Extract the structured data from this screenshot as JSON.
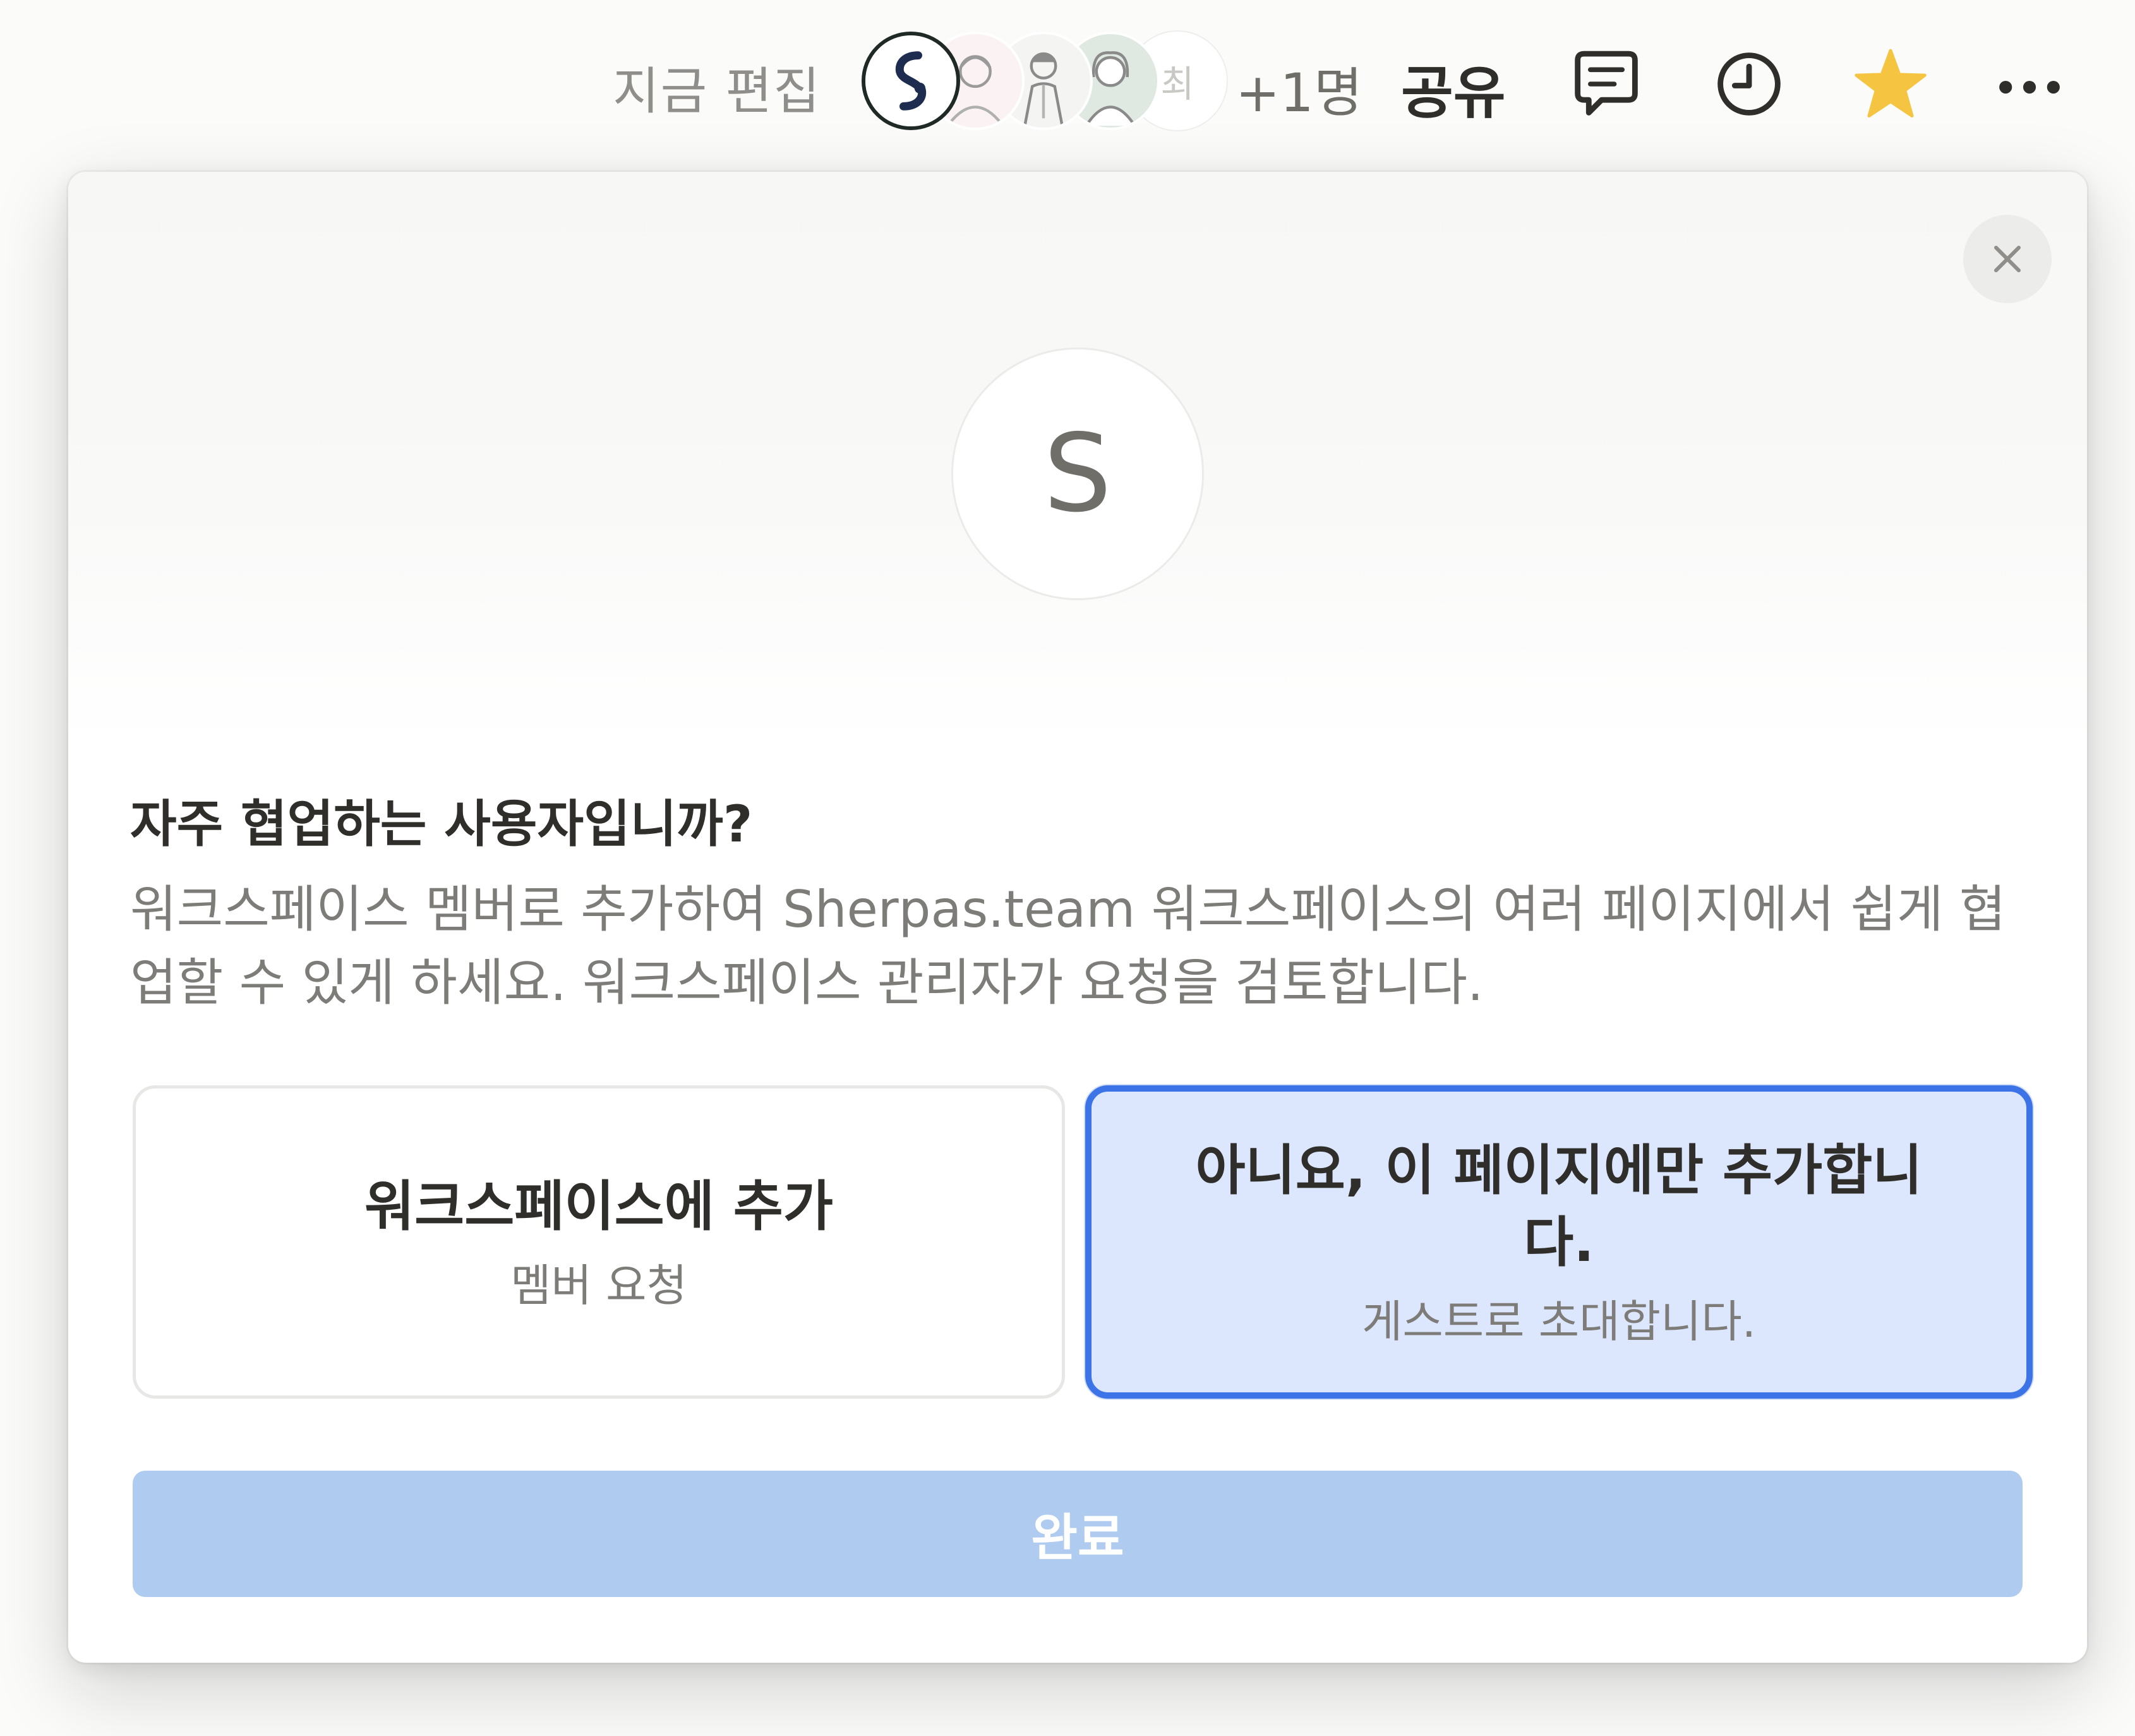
{
  "topbar": {
    "edit_status": "지금 편집",
    "avatars": [
      {
        "name": "brand-logo-avatar"
      },
      {
        "name": "user-avatar-1"
      },
      {
        "name": "user-avatar-2"
      },
      {
        "name": "user-avatar-3"
      },
      {
        "name": "user-avatar-4",
        "initial": "최"
      }
    ],
    "more_count": "+1명",
    "share_label": "공유",
    "icons": {
      "comment": "comment-icon",
      "history": "clock-icon",
      "favorite": "star-icon",
      "more": "more-dots-icon"
    },
    "star_color": "#f5c542"
  },
  "modal": {
    "workspace_initial": "S",
    "title": "자주 협업하는 사용자입니까?",
    "description": "워크스페이스 멤버로 추가하여 Sherpas.team 워크스페이스의 여러 페이지에서 쉽게 협업할 수 있게 하세요. 워크스페이스 관리자가 요청을 검토합니다.",
    "options": [
      {
        "title": "워크스페이스에 추가",
        "subtitle": "멤버 요청",
        "selected": false
      },
      {
        "title": "아니요, 이 페이지에만 추가합니다.",
        "subtitle": "게스트로 초대합니다.",
        "selected": true
      }
    ],
    "done_label": "완료",
    "accent_color": "#3c74e8",
    "done_color": "#b0cbf0"
  }
}
